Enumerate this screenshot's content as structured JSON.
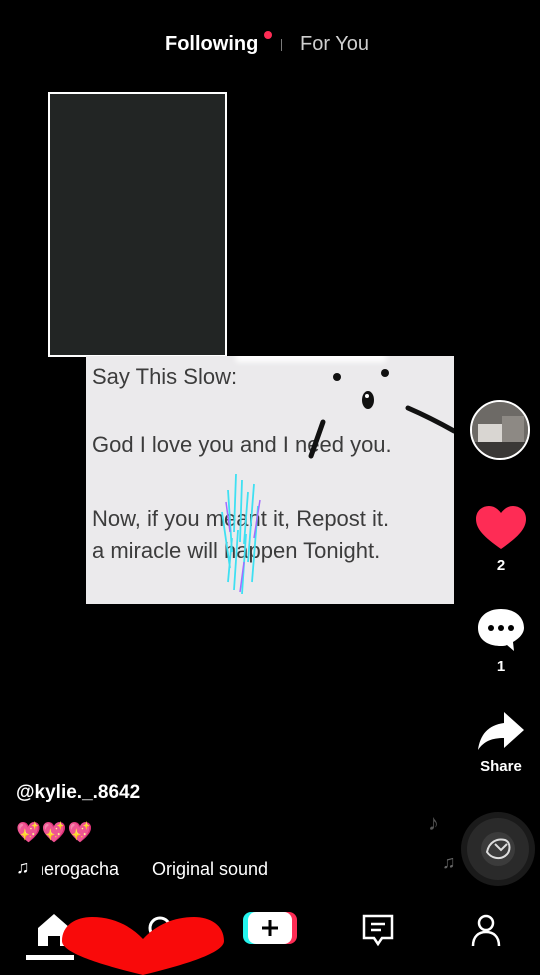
{
  "top_tabs": {
    "following": "Following",
    "for_you": "For You"
  },
  "video_text": {
    "line1": "Say This Slow:",
    "line2": "God I love you and I need you.",
    "line3": "Now, if you meant it, Repost it.",
    "line4": "a miracle will happen Tonight."
  },
  "actions": {
    "likes": "2",
    "comments": "1",
    "share_label": "Share"
  },
  "post": {
    "username": "@kylie._.8642",
    "caption": "💖💖💖",
    "sound_author": "herogacha",
    "sound_title": "Original sound"
  },
  "colors": {
    "accent": "#fe2c55",
    "caption_pink": "#ff70c8"
  },
  "icons": {
    "home": "home-icon",
    "search": "search-icon",
    "create": "plus-icon",
    "inbox": "inbox-icon",
    "profile": "profile-icon",
    "like": "heart-icon",
    "comment": "comment-bubble-icon",
    "share": "share-arrow-icon",
    "music": "music-note-icon"
  }
}
